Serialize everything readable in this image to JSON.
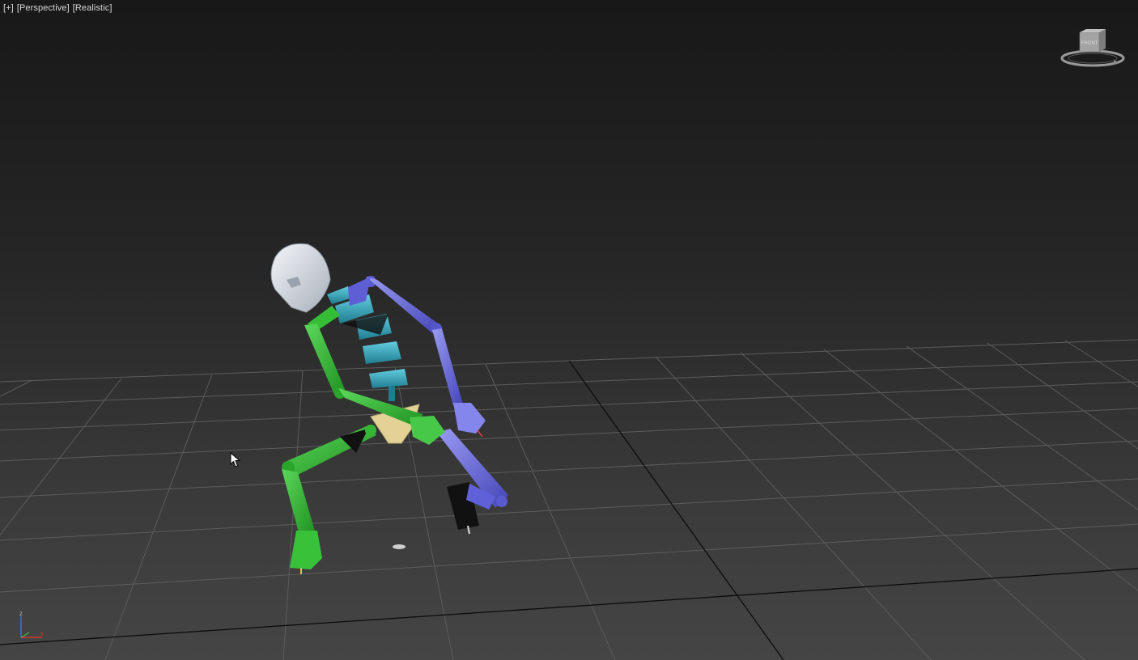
{
  "viewport": {
    "label_plus": "[+]",
    "label_view": "[Perspective]",
    "label_shading": "[Realistic]"
  },
  "viewcube": {
    "face_label": "FRONT"
  },
  "axis_tripod": {
    "z_label": "z",
    "x_label": "x"
  },
  "colors": {
    "grid_line": "#5a5a5a",
    "grid_axis": "#101010",
    "head": "#d9dde3",
    "spine": "#3aa9c0",
    "left_limbs": "#2fb52f",
    "right_limbs": "#6a6be0",
    "pelvis": "#e6d49a"
  }
}
